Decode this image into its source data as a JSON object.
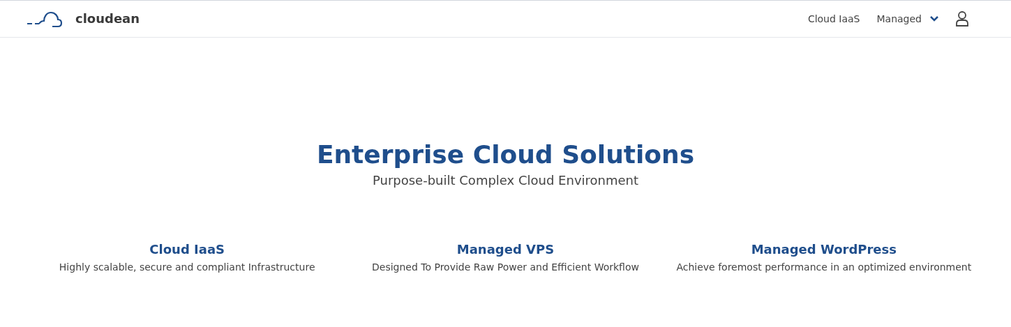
{
  "header": {
    "logo": "cloudean",
    "nav": [
      {
        "label": "Cloud IaaS",
        "kind": "link"
      },
      {
        "label": "Managed",
        "kind": "dropdown"
      }
    ]
  },
  "hero": {
    "title": "Enterprise Cloud Solutions",
    "subtitle": "Purpose-built Complex Cloud Environment"
  },
  "features": [
    {
      "title": "Cloud IaaS",
      "description": "Highly scalable, secure and compliant Infrastructure"
    },
    {
      "title": "Managed VPS",
      "description": "Designed To Provide Raw Power and Efficient Workflow"
    },
    {
      "title": "Managed WordPress",
      "description": "Achieve foremost performance in an optimized environment"
    }
  ]
}
